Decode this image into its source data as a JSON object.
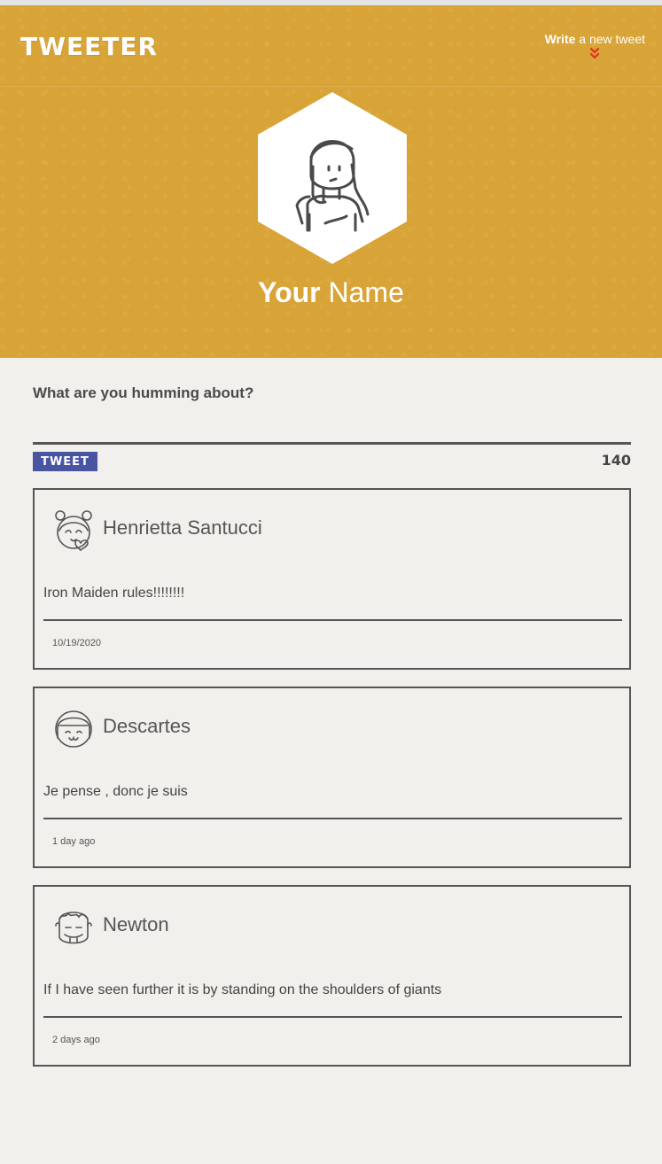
{
  "nav": {
    "brand": "TWEETER",
    "compose_bold": "Write",
    "compose_rest": " a new tweet"
  },
  "profile": {
    "name_bold": "Your",
    "name_rest": " Name"
  },
  "compose": {
    "label": "What are you humming about?",
    "value": "",
    "button_label": "TWEET",
    "counter": "140"
  },
  "tweets": [
    {
      "author": "Henrietta Santucci",
      "content": "Iron Maiden rules!!!!!!!!",
      "timestamp": "10/19/2020"
    },
    {
      "author": "Descartes",
      "content": "Je pense , donc je suis",
      "timestamp": "1 day ago"
    },
    {
      "author": "Newton",
      "content": "If I have seen further it is by standing on the shoulders of giants",
      "timestamp": "2 days ago"
    }
  ],
  "colors": {
    "header": "#d9a437",
    "background": "#f1f0ec",
    "button": "#4a55a2",
    "chevron": "#e0301e"
  },
  "icons": [
    "chevron-double-down-icon",
    "user-avatar-icon"
  ]
}
